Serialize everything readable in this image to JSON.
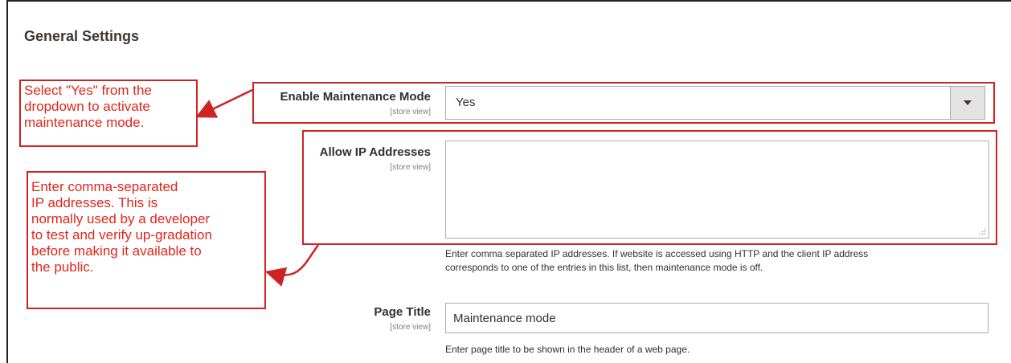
{
  "section": {
    "title": "General Settings"
  },
  "fields": {
    "maintenance_mode": {
      "label": "Enable Maintenance Mode",
      "scope": "[store view]",
      "value": "Yes"
    },
    "allow_ip": {
      "label": "Allow IP Addresses",
      "scope": "[store view]",
      "value": "",
      "note_lines": [
        "Enter comma separated IP addresses. If website is accessed using HTTP and the client IP address",
        "corresponds to one of the entries in this list, then maintenance mode is off."
      ]
    },
    "page_title": {
      "label": "Page Title",
      "scope": "[store view]",
      "value": "Maintenance mode",
      "note": "Enter page title to be shown in the header of a web page."
    }
  },
  "annotations": {
    "callout1_lines": [
      "Select \"Yes\" from the",
      "dropdown to activate",
      "maintenance mode."
    ],
    "callout2_lines": [
      "Enter comma-separated",
      "IP addresses. This is",
      "normally used by a developer",
      "to test and verify up-gradation",
      "before making it available to",
      "the public."
    ],
    "color": "#cf2323"
  },
  "icons": {
    "select_arrow": "caret-down-icon",
    "resize": "resize-grip-icon"
  }
}
